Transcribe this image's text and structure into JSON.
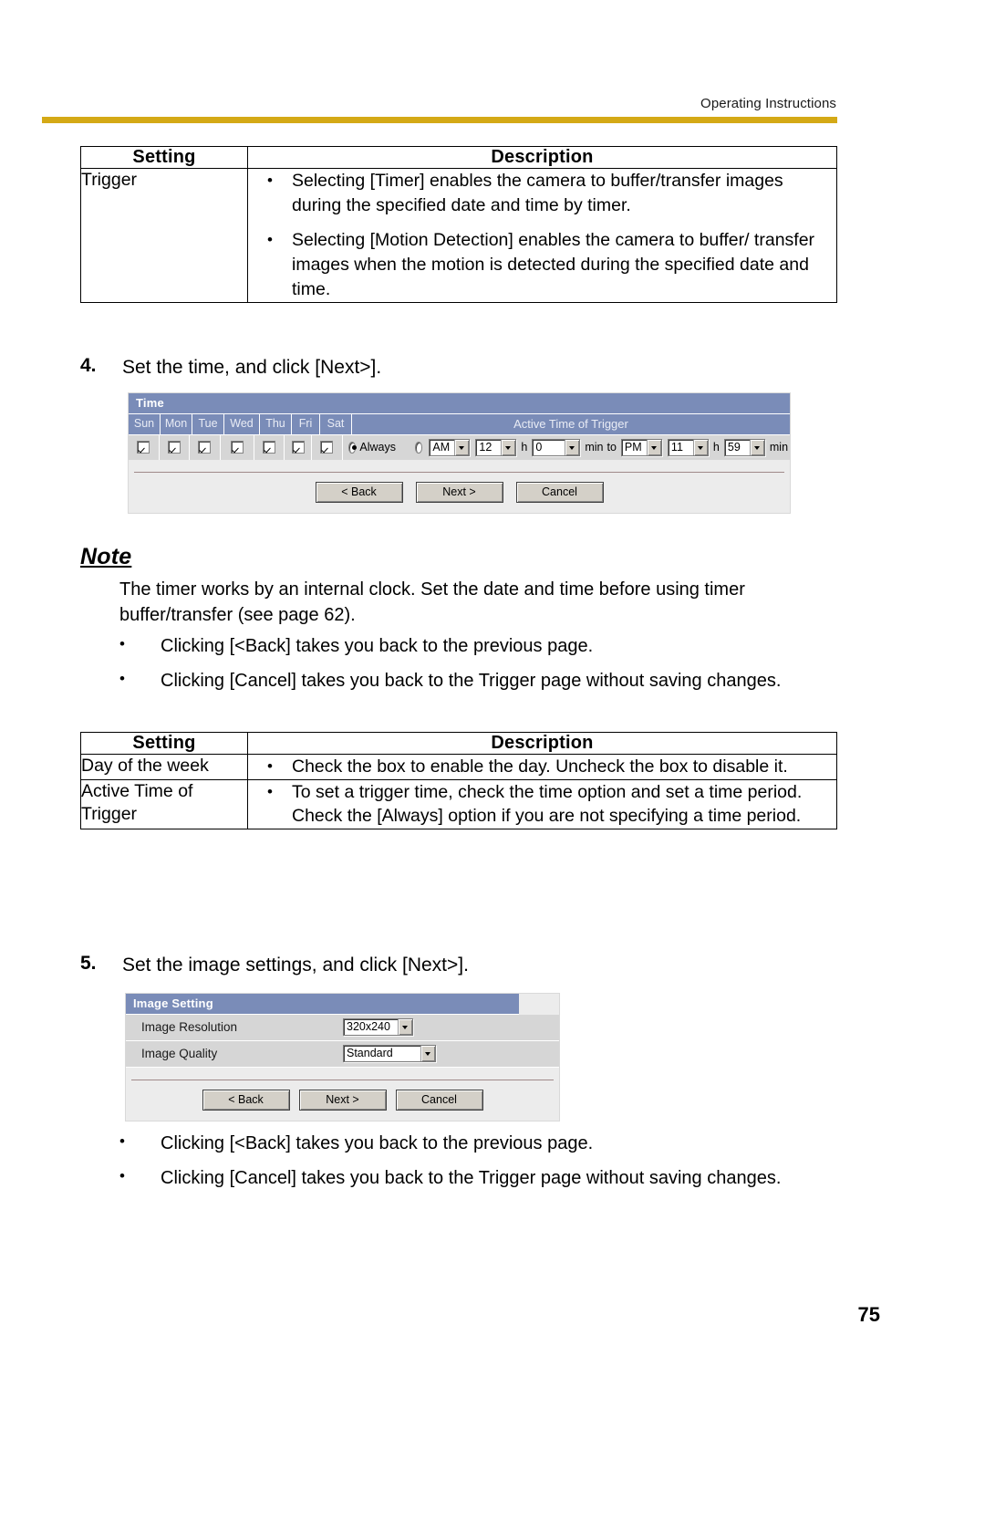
{
  "header": {
    "running_title": "Operating Instructions"
  },
  "table_trigger": {
    "columns": [
      "Setting",
      "Description"
    ],
    "rows": [
      {
        "setting": "Trigger",
        "bullets": [
          "Selecting [Timer] enables the camera to buffer/transfer images during the specified date and time by timer.",
          "Selecting [Motion Detection] enables the camera to buffer/ transfer images when the motion is detected during the specified date and time."
        ]
      }
    ]
  },
  "step4": {
    "number": "4.",
    "text": "Set the time, and click [Next>]."
  },
  "time_screenshot": {
    "title": "Time",
    "day_headers": [
      "Sun",
      "Mon",
      "Tue",
      "Wed",
      "Thu",
      "Fri",
      "Sat"
    ],
    "active_time_header": "Active Time of Trigger",
    "days_checked": [
      true,
      true,
      true,
      true,
      true,
      true,
      true
    ],
    "always_label": "Always",
    "always_selected": true,
    "time_option_selected": false,
    "start_meridiem": "AM",
    "start_hour": "12",
    "hour_unit": "h",
    "start_minute": "0",
    "minute_unit": "min",
    "to_label": "to",
    "end_meridiem": "PM",
    "end_hour": "11",
    "end_minute": "59",
    "buttons": [
      "< Back",
      "Next >",
      "Cancel"
    ]
  },
  "note": {
    "title": "Note",
    "body": "The timer works by an internal clock. Set the date and time before using timer buffer/transfer (see page 62).",
    "bullets": [
      "Clicking [<Back] takes you back to the previous page.",
      "Clicking [Cancel] takes you back to the Trigger page without saving changes."
    ]
  },
  "table_time": {
    "columns": [
      "Setting",
      "Description"
    ],
    "rows": [
      {
        "setting": "Day of the week",
        "bullets": [
          "Check the box to enable the day. Uncheck the box to disable it."
        ]
      },
      {
        "setting": "Active Time of Trigger",
        "bullets": [
          "To set a trigger time, check the time option and set a time period. Check the [Always] option if you are not specifying a time period."
        ]
      }
    ]
  },
  "step5": {
    "number": "5.",
    "text": "Set the image settings, and click [Next>]."
  },
  "image_screenshot": {
    "title": "Image Setting",
    "rows": [
      {
        "label": "Image Resolution",
        "value": "320x240"
      },
      {
        "label": "Image Quality",
        "value": "Standard"
      }
    ],
    "buttons": [
      "< Back",
      "Next >",
      "Cancel"
    ]
  },
  "bottom_bullets": [
    "Clicking [<Back] takes you back to the previous page.",
    "Clicking [Cancel] takes you back to the Trigger page without saving changes."
  ],
  "page_number": "75",
  "colors": {
    "header_rule": "#d4a916",
    "panel_title_bg": "#7a8cb8",
    "panel_body_bg": "#d6d6d6",
    "panel_outer_bg": "#ececec"
  }
}
